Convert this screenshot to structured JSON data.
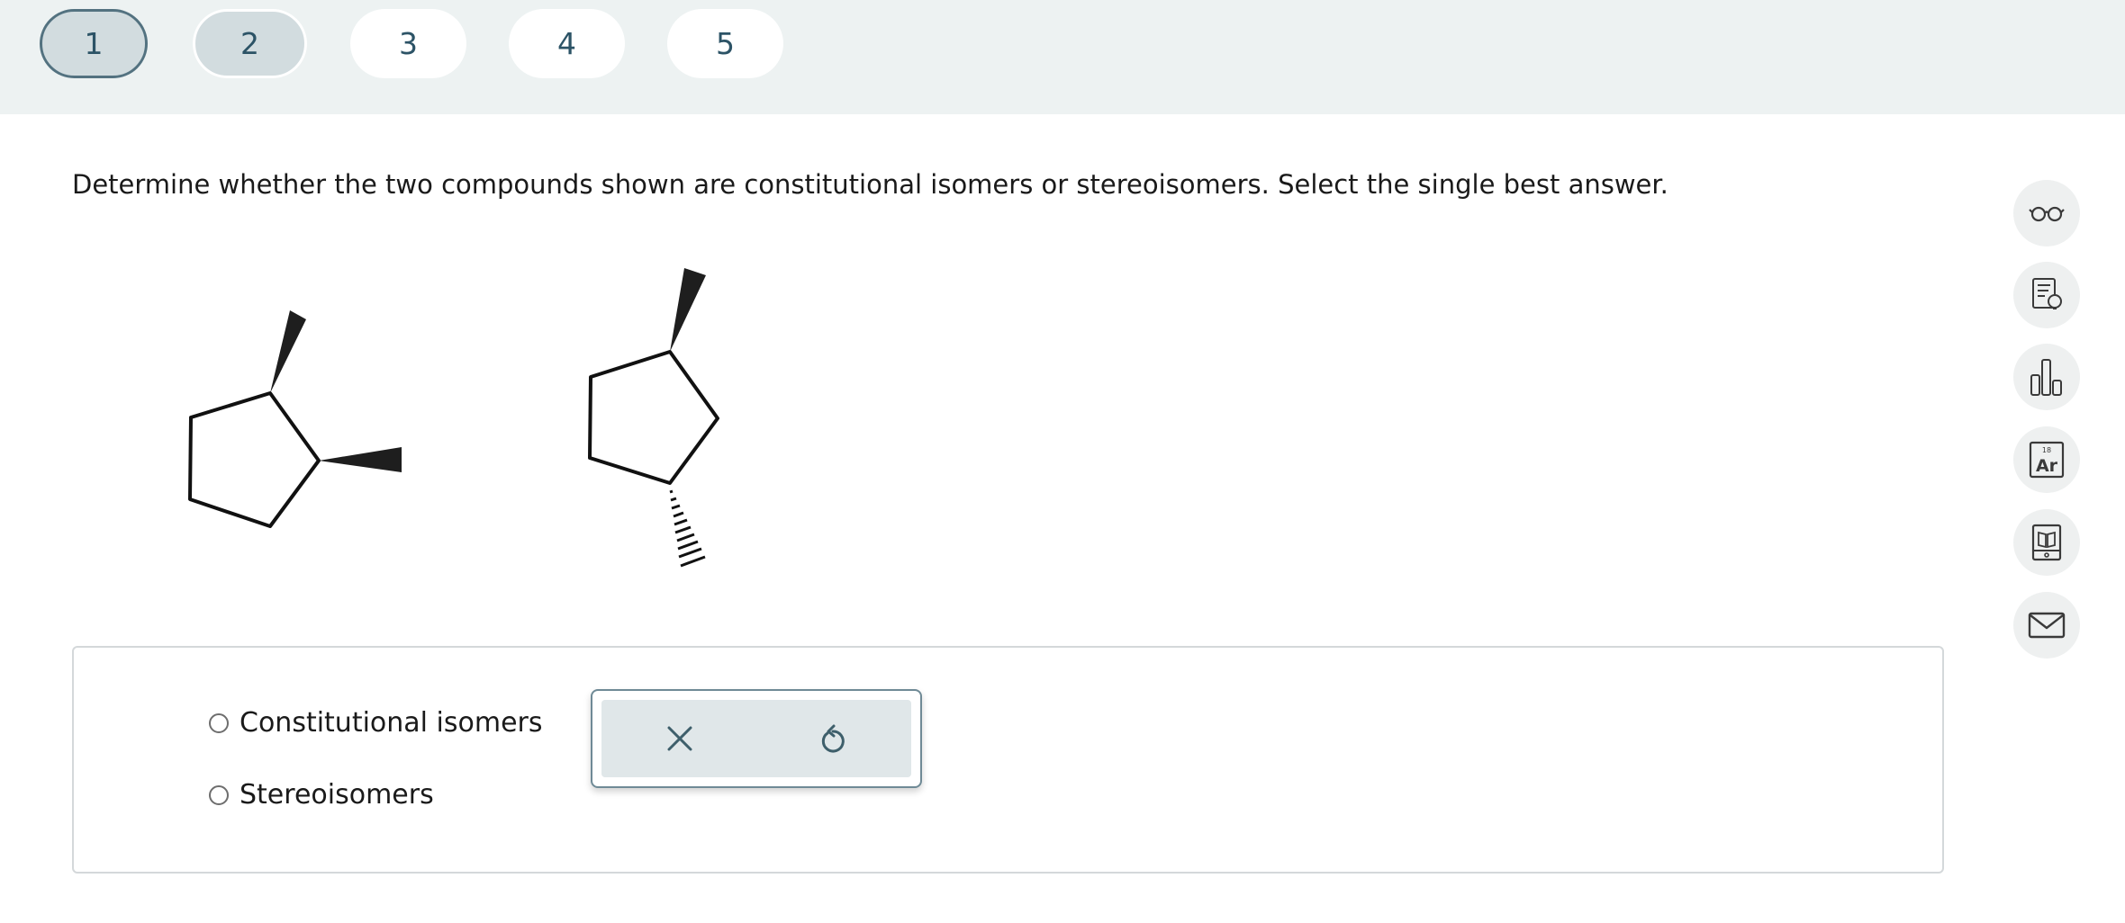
{
  "question_nav": {
    "tabs": [
      {
        "label": "1",
        "state": "current"
      },
      {
        "label": "2",
        "state": "visited"
      },
      {
        "label": "3",
        "state": "unvisited"
      },
      {
        "label": "4",
        "state": "unvisited"
      },
      {
        "label": "5",
        "state": "unvisited"
      }
    ]
  },
  "question": {
    "prompt": "Determine whether the two compounds shown are constitutional isomers or stereoisomers. Select the single best answer."
  },
  "answer_choices": [
    {
      "label": "Constitutional isomers",
      "selected": false
    },
    {
      "label": "Stereoisomers",
      "selected": false
    }
  ],
  "answer_tools": {
    "clear_icon": "close-icon",
    "undo_icon": "undo-icon"
  },
  "periodic_table_icon": {
    "atomic_number": "18",
    "symbol": "Ar"
  },
  "sidebar": {
    "tools": [
      "glasses-icon",
      "hint-icon",
      "chart-icon",
      "periodic-table-icon",
      "ebook-icon",
      "mail-icon"
    ]
  },
  "colors": {
    "nav_bar_bg": "#edf2f2",
    "tab_text": "#2c5366",
    "current_tab_border": "#537280",
    "tool_panel_bg": "#e0e7e9",
    "icon_color": "#3e5f6b"
  }
}
